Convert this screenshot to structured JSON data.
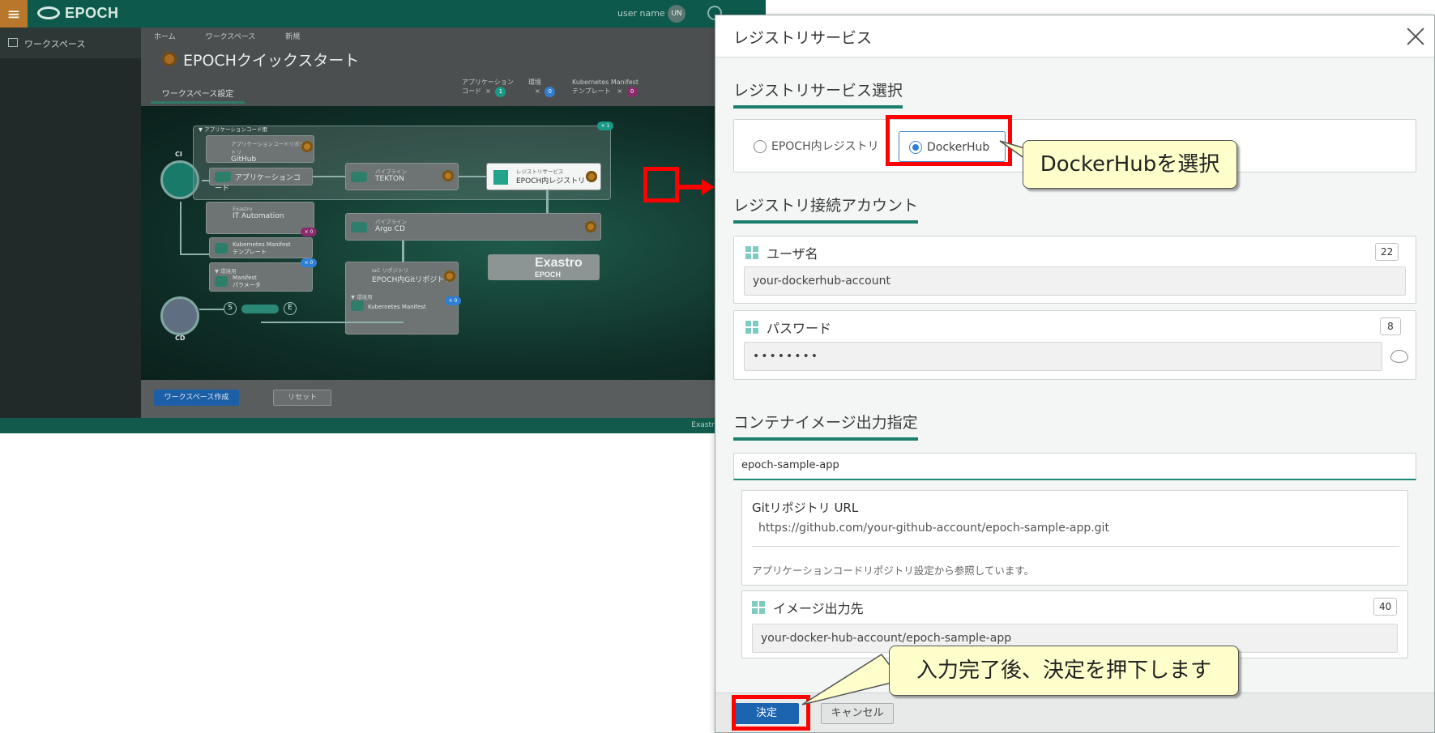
{
  "app": {
    "menu_icon": "≡",
    "logo": "EPOCH",
    "user_name": "user name",
    "avatar_initials": "UN",
    "sidebar_items": [
      "ワークスペース"
    ],
    "breadcrumb": [
      "ホーム",
      "ワークスペース",
      "新規"
    ],
    "page_title": "EPOCHクイックスタート",
    "tab_label": "ワークスペース設定",
    "counts": [
      {
        "label_1": "アプリケーション",
        "label_2": "コード",
        "value": "1",
        "color": "#1a9a86"
      },
      {
        "label_1": "環境",
        "label_2": "",
        "value": "0",
        "color": "#2f7fd2"
      },
      {
        "label_1": "Kubernetes Manifest",
        "label_2": "テンプレート",
        "value": "0",
        "color": "#8a2a6b"
      }
    ],
    "flow": {
      "ci_label": "CI",
      "cd_label": "CD",
      "app_code_group": "▼ アプリケーションコード用",
      "github_sub": "アプリケーションコードリポジトリ",
      "github": "GitHub",
      "app_code": "アプリケーションコード",
      "tekton_sub": "パイプライン",
      "tekton": "TEKTON",
      "registry_sub": "レジストリサービス",
      "registry": "EPOCH内レジストリ",
      "ita_sub": "Exastro",
      "ita": "IT Automation",
      "k8s_template_1": "Kubernetes Manifest",
      "k8s_template_2": "テンプレート",
      "env_group": "▼ 環境用",
      "manifest_1": "Manifest",
      "manifest_2": "パラメータ",
      "argo_sub": "パイプライン",
      "argo": "Argo CD",
      "iac_sub": "IaC リポジトリ",
      "iac": "EPOCH内Gitリポジトリ",
      "iac_group": "▼ 環境用",
      "k8s_manifest": "Kubernetes Manifest",
      "exastro_logo_1": "Exastro",
      "exastro_logo_2": "EPOCH",
      "badge_x1": "× 1",
      "badge_x0": "× 0",
      "s_node": "S",
      "e_node": "E"
    },
    "create_button": "ワークスペース作成",
    "reset_button": "リセット",
    "footer": "Exastro EPOCH Ve"
  },
  "dialog": {
    "title": "レジストリサービス",
    "section_select": "レジストリサービス選択",
    "radio_options": [
      {
        "label": "EPOCH内レジストリ",
        "selected": false
      },
      {
        "label": "DockerHub",
        "selected": true
      }
    ],
    "section_account": "レジストリ接続アカウント",
    "username": {
      "label": "ユーザ名",
      "counter": "22",
      "value": "your-dockerhub-account"
    },
    "password": {
      "label": "パスワード",
      "counter": "8",
      "value": "••••••••"
    },
    "section_image": "コンテナイメージ出力指定",
    "image_app_name": "epoch-sample-app",
    "git_repo": {
      "label": "Gitリポジトリ URL",
      "value": "https://github.com/your-github-account/epoch-sample-app.git",
      "note": "アプリケーションコードリポジトリ設定から参照しています。"
    },
    "image_output": {
      "label": "イメージ出力先",
      "counter": "40",
      "value": "your-docker-hub-account/epoch-sample-app"
    },
    "ok_button": "決定",
    "cancel_button": "キャンセル"
  },
  "annotations": {
    "callout_select": "DockerHubを選択",
    "callout_submit": "入力完了後、決定を押下します",
    "highlight_color": "#ff0000"
  },
  "colors": {
    "accent": "#1b7f6d",
    "primary_button": "#1c63b0",
    "callout_fill": "#ffffcc"
  }
}
